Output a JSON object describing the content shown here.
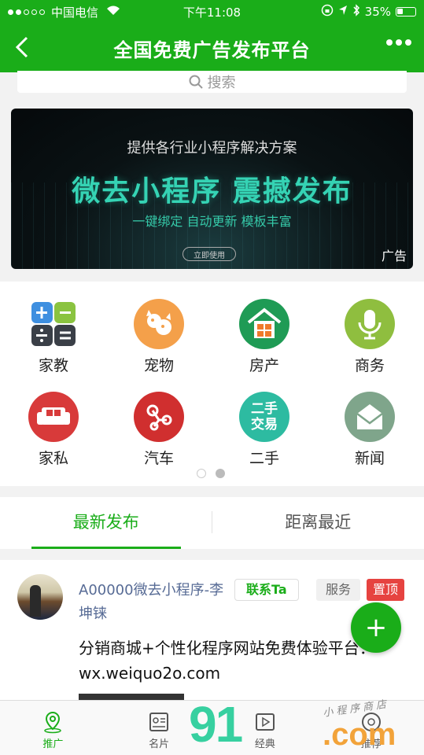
{
  "status_bar": {
    "carrier": "中国电信",
    "time": "下午11:08",
    "battery": "35%"
  },
  "navbar": {
    "title": "全国免费广告发布平台"
  },
  "search": {
    "placeholder": "搜索"
  },
  "banner": {
    "subtitle": "提供各行业小程序解决方案",
    "headline": "微去小程序  震撼发布",
    "features": "一键绑定  自动更新  模板丰富",
    "button": "立即使用",
    "ad_label": "广告"
  },
  "categories": [
    {
      "label": "家教",
      "icon": "calculator-icon",
      "color": "#3a3f47"
    },
    {
      "label": "宠物",
      "icon": "pet-icon",
      "color": "#f0a24a"
    },
    {
      "label": "房产",
      "icon": "house-icon",
      "color": "#1f9b55"
    },
    {
      "label": "商务",
      "icon": "microphone-icon",
      "color": "#8fbe3f"
    },
    {
      "label": "家私",
      "icon": "sofa-icon",
      "color": "#d83a3a"
    },
    {
      "label": "汽车",
      "icon": "share-nodes-icon",
      "color": "#d02f2f"
    },
    {
      "label": "二手",
      "icon": "second-hand-trade-icon",
      "color": "#2dbba1",
      "icon_text": "二手交易"
    },
    {
      "label": "新闻",
      "icon": "envelope-icon",
      "color": "#7fa58b"
    }
  ],
  "pager": {
    "total": 2,
    "active": 1
  },
  "tabs": [
    {
      "label": "最新发布",
      "active": true
    },
    {
      "label": "距离最近",
      "active": false
    }
  ],
  "post": {
    "author": "A00000微去小程序-李坤铼",
    "contact_button": "联系Ta",
    "category_tag": "服务",
    "pinned_tag": "置顶",
    "content": "分销商城+个性化程序网站免费体验平台：wx.weiquo2o.com"
  },
  "fab": {
    "label": "+"
  },
  "bottom_tabs": [
    {
      "label": "推广",
      "icon": "location-pin-icon",
      "active": true
    },
    {
      "label": "名片",
      "icon": "business-card-icon",
      "active": false
    },
    {
      "label": "经典",
      "icon": "video-icon",
      "active": false
    },
    {
      "label": "推荐",
      "icon": "recommend-icon",
      "active": false
    }
  ],
  "watermark": {
    "brand": "91",
    "suffix": ".com",
    "handwriting": "小程序商店"
  },
  "colors": {
    "brand_green": "#1aad19",
    "link_blue": "#576b95",
    "pin_red": "#e64340"
  }
}
